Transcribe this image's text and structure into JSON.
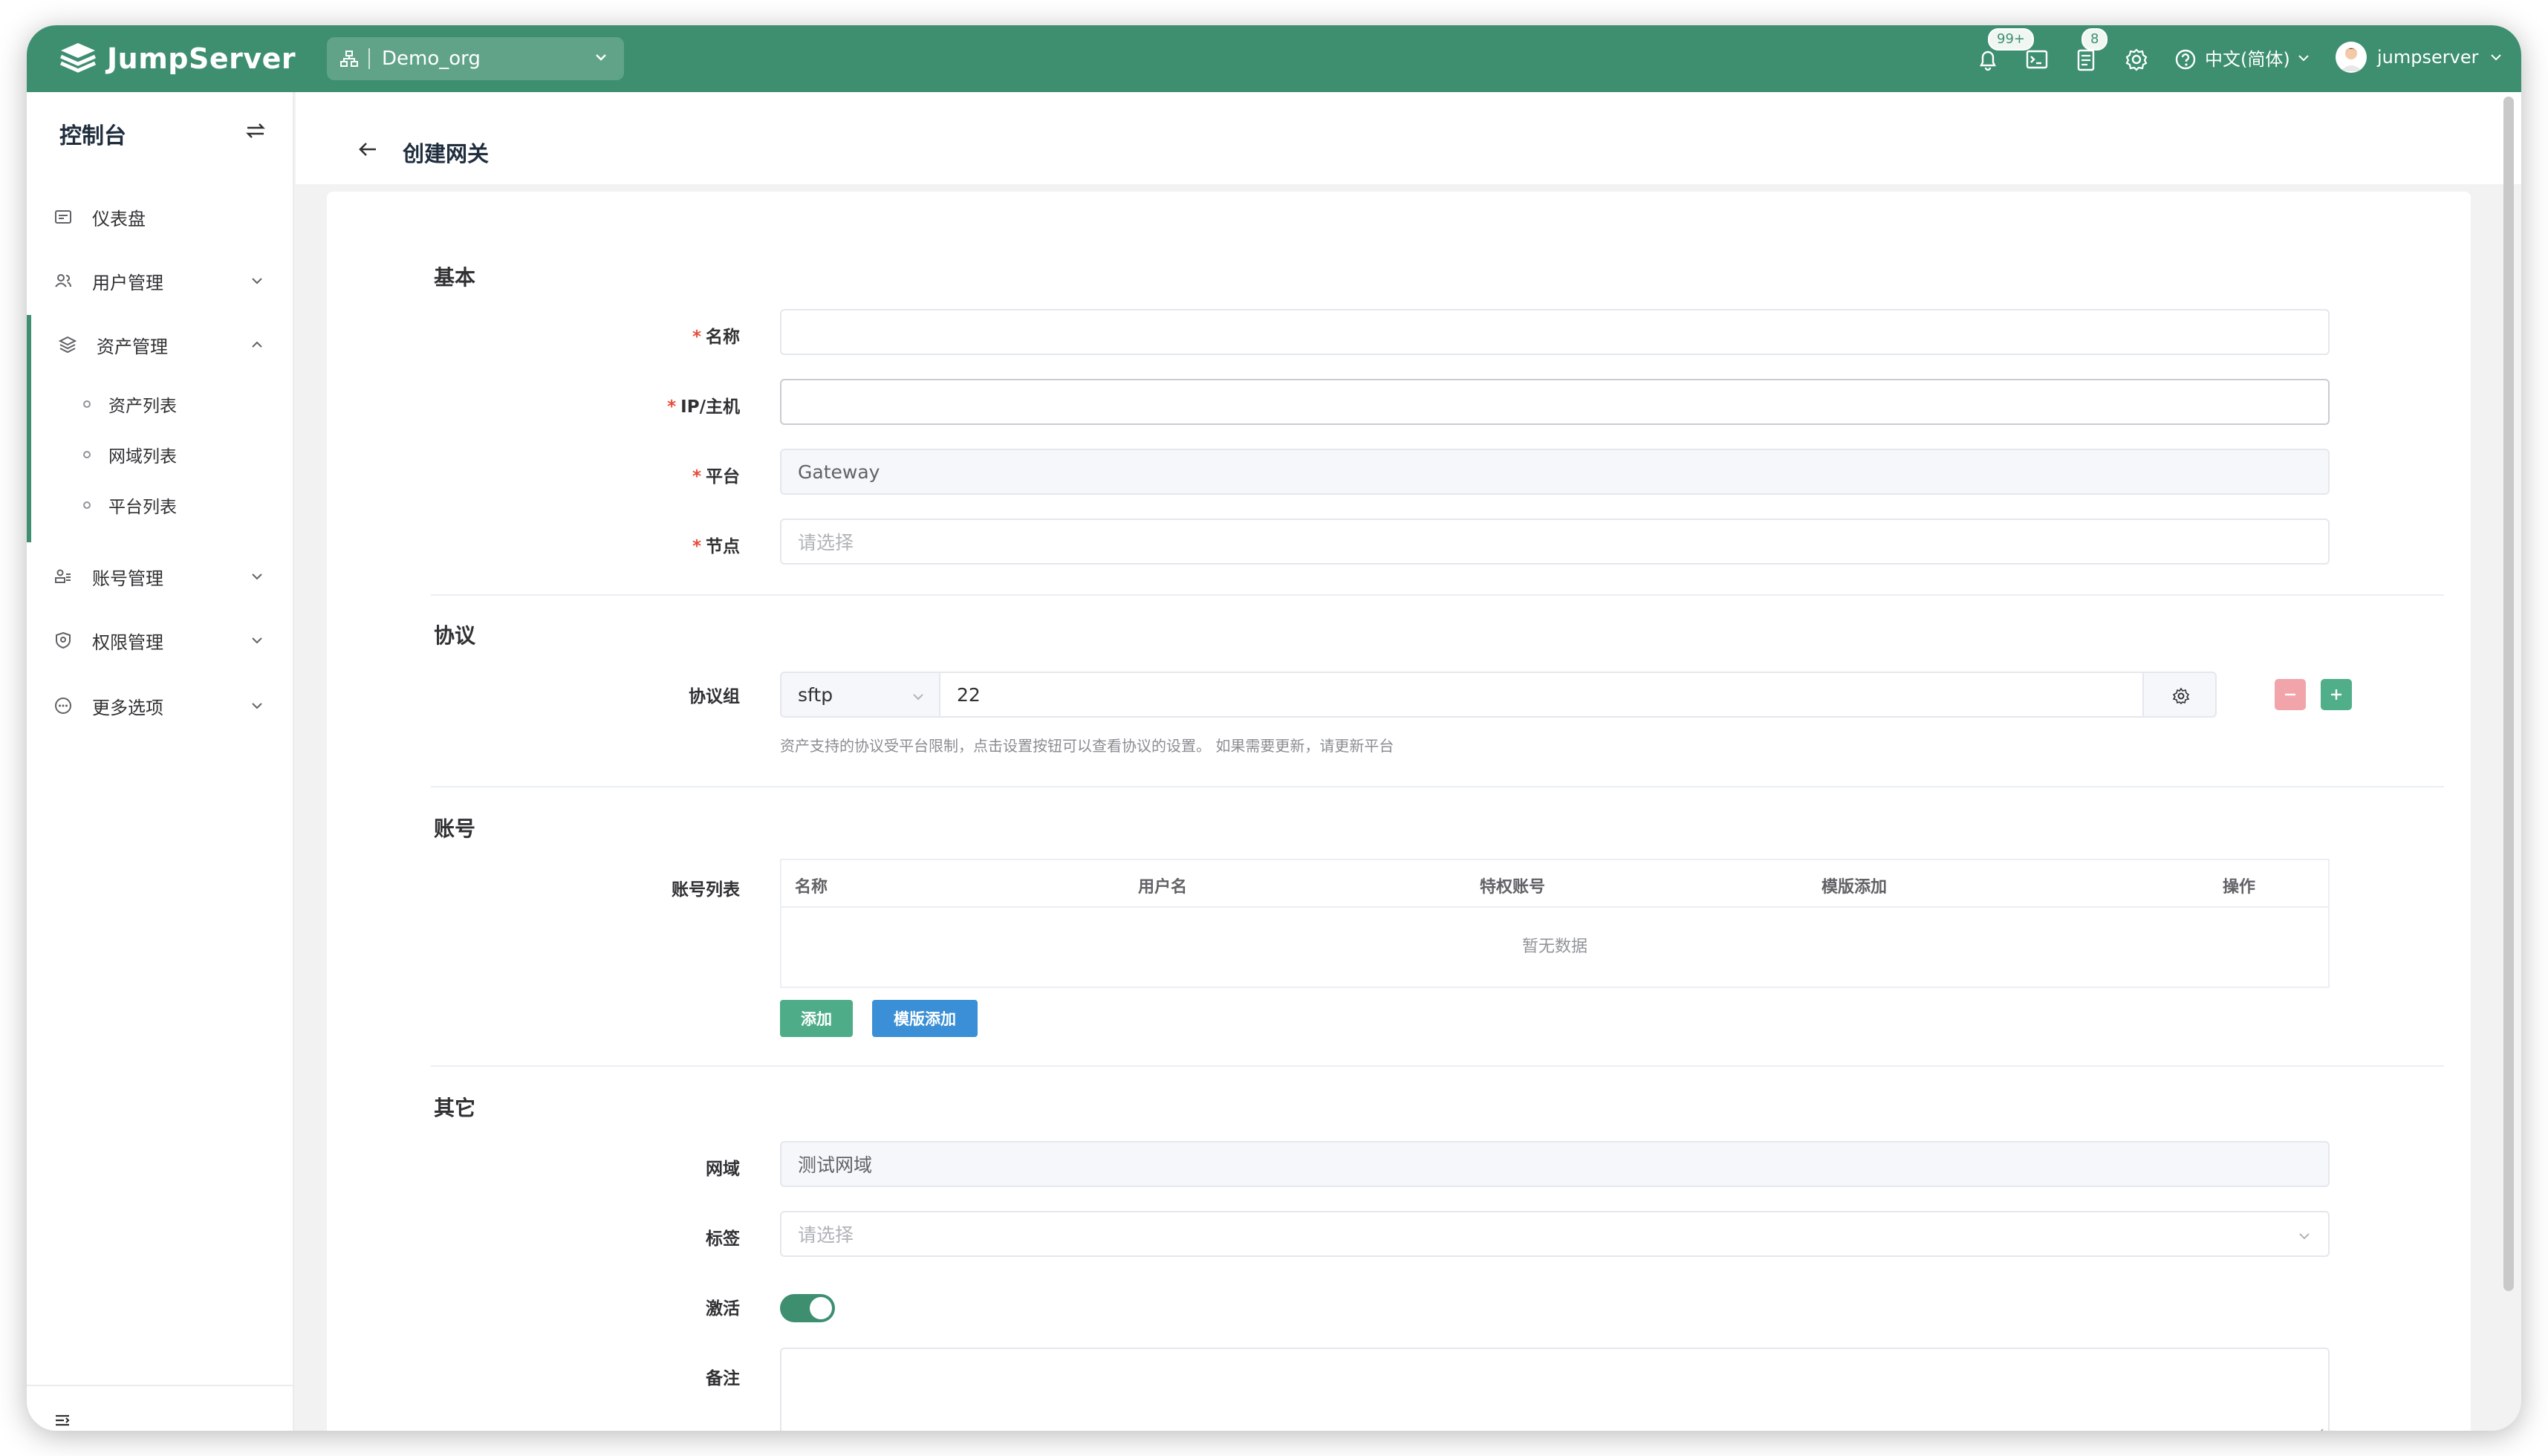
{
  "header": {
    "logo_text": "JumpServer",
    "org_name": "Demo_org",
    "notification_badge": "99+",
    "tasks_badge": "8",
    "language": "中文(简体)",
    "username": "jumpserver",
    "accent_color": "#3d8f70"
  },
  "sidebar": {
    "title": "控制台",
    "items": [
      {
        "label": "仪表盘",
        "icon": "dashboard-icon"
      },
      {
        "label": "用户管理",
        "icon": "users-icon"
      },
      {
        "label": "资产管理",
        "icon": "layers-icon"
      },
      {
        "label": "账号管理",
        "icon": "accounts-icon"
      },
      {
        "label": "权限管理",
        "icon": "shield-icon"
      },
      {
        "label": "更多选项",
        "icon": "more-icon"
      }
    ],
    "sub_items": [
      "资产列表",
      "网域列表",
      "平台列表"
    ]
  },
  "page": {
    "title": "创建网关"
  },
  "form": {
    "basic": {
      "section": "基本",
      "name_label": "名称",
      "name_value": "",
      "host_label": "IP/主机",
      "host_value": "",
      "platform_label": "平台",
      "platform_value": "Gateway",
      "node_label": "节点",
      "node_placeholder": "请选择"
    },
    "protocol": {
      "section": "协议",
      "group_label": "协议组",
      "protocol": "sftp",
      "port": "22",
      "hint": "资产支持的协议受平台限制，点击设置按钮可以查看协议的设置。 如果需要更新，请更新平台"
    },
    "accounts": {
      "section": "账号",
      "list_label": "账号列表",
      "columns": [
        "名称",
        "用户名",
        "特权账号",
        "模版添加",
        "操作"
      ],
      "empty_text": "暂无数据",
      "add_button": "添加",
      "template_button": "模版添加"
    },
    "other": {
      "section": "其它",
      "domain_label": "网域",
      "domain_value": "测试网域",
      "tags_label": "标签",
      "tags_placeholder": "请选择",
      "active_label": "激活",
      "active_value": true,
      "comment_label": "备注"
    }
  }
}
